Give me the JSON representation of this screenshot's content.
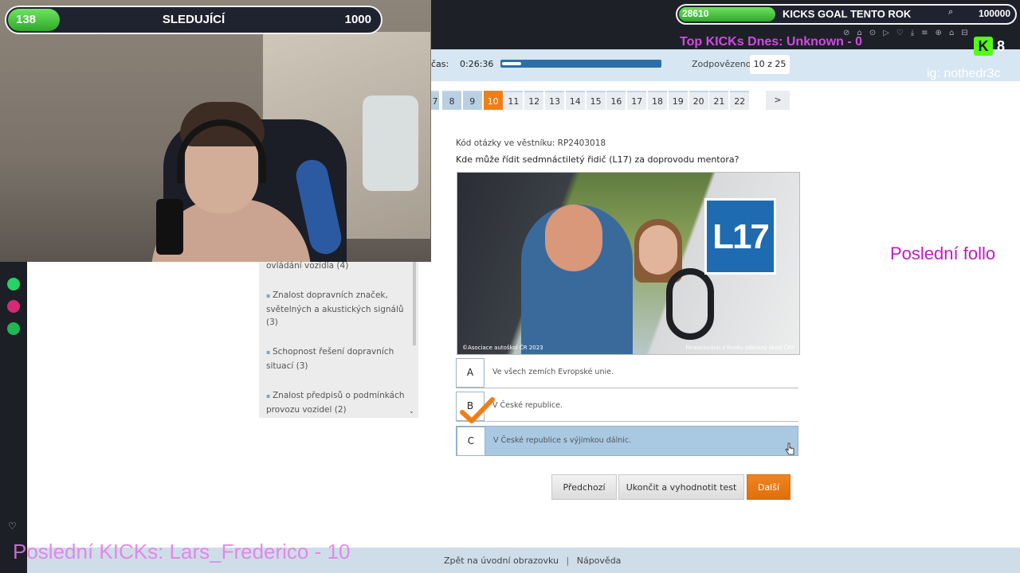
{
  "overlay": {
    "followers": {
      "count": "138",
      "label": "SLEDUJÍCÍ",
      "goal": "1000",
      "progress": 0.138
    },
    "kicks": {
      "count": "28610",
      "label": "KICKS GOAL TENTO ROK",
      "goal": "100000",
      "progress": 0.286
    },
    "top_kicks": "Top KICKs Dnes: Unknown - 0",
    "kick_badge_count": "8",
    "ig_handle": "ig: nothedr3c",
    "last_follow": "Poslední follo",
    "last_kicks": "Poslední KICKs: Lars_Frederico - 10"
  },
  "test": {
    "time_label": "čas:",
    "time_value": "0:26:36",
    "time_progress": 0.12,
    "answered_label": "Zodpovězeno",
    "answered_value": "10 z 25",
    "question_numbers": [
      {
        "n": "7",
        "state": "answered"
      },
      {
        "n": "8",
        "state": "answered"
      },
      {
        "n": "9",
        "state": "answered"
      },
      {
        "n": "10",
        "state": "current"
      },
      {
        "n": "11",
        "state": "open"
      },
      {
        "n": "12",
        "state": "open"
      },
      {
        "n": "13",
        "state": "open"
      },
      {
        "n": "14",
        "state": "open"
      },
      {
        "n": "15",
        "state": "open"
      },
      {
        "n": "16",
        "state": "open"
      },
      {
        "n": "17",
        "state": "open"
      },
      {
        "n": "18",
        "state": "open"
      },
      {
        "n": "19",
        "state": "open"
      },
      {
        "n": "20",
        "state": "open"
      },
      {
        "n": "21",
        "state": "open"
      },
      {
        "n": "22",
        "state": "open"
      }
    ],
    "next_arrow": ">",
    "question_code": "Kód otázky ve věstníku: RP2403018",
    "question_text": "Kde může řídit sedmnáctiletý řidič (L17) za doprovodu mentora?",
    "image": {
      "badge": "L17",
      "credit_left": "©Asociace autoškol ČR 2023",
      "credit_right": "Financováno z fondu zábrany škod ČKP"
    },
    "answers": [
      {
        "letter": "A",
        "text": "Ve všech zemích Evropské unie."
      },
      {
        "letter": "B",
        "text": "V České republice."
      },
      {
        "letter": "C",
        "text": "V České republice s výjimkou dálnic."
      }
    ],
    "selected_answer": "B",
    "buttons": {
      "prev": "Předchozí",
      "end": "Ukončit a vyhodnotit test",
      "next": "Další"
    }
  },
  "topics": [
    "ovládání vozidla (4)",
    "Znalost dopravních značek, světelných a akustických signálů (3)",
    "Schopnost řešení dopravních situací (3)",
    "Znalost předpisů o podmínkách provozu vozidel (2)"
  ],
  "footer": {
    "home": "Zpět na úvodní obrazovku",
    "separator": "|",
    "help": "Nápověda"
  },
  "browser_icons": "⊘⌂⊙▷♡⤓≡⊕⌂⊟",
  "colors": {
    "accent_orange": "#f07e18",
    "kick_green": "#53fc18",
    "overlay_magenta": "#c218c8"
  }
}
